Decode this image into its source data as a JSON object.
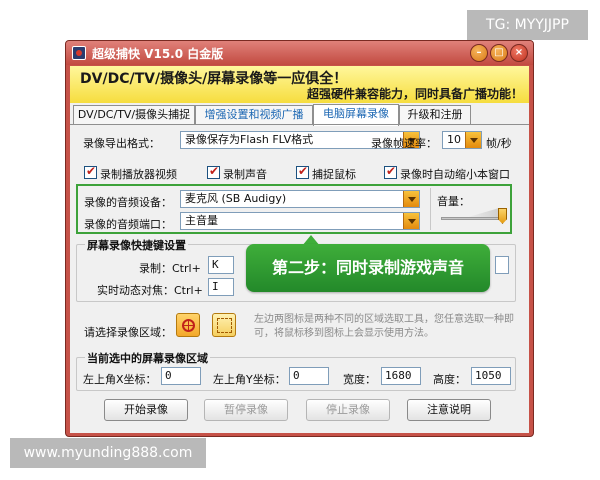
{
  "watermark": {
    "top_right": "TG: MYYJJPP",
    "bottom_left": "www.myunding888.com"
  },
  "window": {
    "title": "超级捕快 V15.0 白金版",
    "controls": {
      "minimize": "–",
      "maximize": "□",
      "close": "×"
    }
  },
  "banner": {
    "line1": "DV/DC/TV/摄像头/屏幕录像等一应俱全！",
    "line2": "超强硬件兼容能力，同时具备广播功能！"
  },
  "tabs": [
    {
      "label": "DV/DC/TV/摄像头捕捉",
      "active": false
    },
    {
      "label": "增强设置和视频广播",
      "active": false
    },
    {
      "label": "电脑屏幕录像",
      "active": true
    },
    {
      "label": "升级和注册",
      "active": false
    }
  ],
  "export_format": {
    "label": "录像导出格式：",
    "value": "录像保存为Flash FLV格式"
  },
  "frame_rate": {
    "label": "录像帧速率：",
    "value": "10",
    "unit": "帧/秒"
  },
  "checkboxes": [
    {
      "label": "录制播放器视频",
      "checked": true
    },
    {
      "label": "录制声音",
      "checked": true
    },
    {
      "label": "捕捉鼠标",
      "checked": true
    },
    {
      "label": "录像时自动缩小本窗口",
      "checked": true
    }
  ],
  "audio": {
    "device_label": "录像的音频设备：",
    "device_value": "麦克风 (SB Audigy)",
    "port_label": "录像的音频端口：",
    "port_value": "主音量",
    "volume_label": "音量：",
    "volume_level": 1.0
  },
  "hotkeys": {
    "title": "屏幕录像快捷键设置",
    "record_label": "录制：Ctrl+",
    "record_key": "K",
    "realtime_label": "实时动态对焦：Ctrl+",
    "realtime_key": "I"
  },
  "callout": "第二步：同时录制游戏声音",
  "area_select": {
    "label": "请选择录像区域：",
    "description": "左边两图标是两种不同的区域选取工具，您任意选取一种即可，将鼠标移到图标上会显示使用方法。"
  },
  "current_area": {
    "title": "当前选中的屏幕录像区域",
    "x_label": "左上角X坐标：",
    "x_value": "0",
    "y_label": "左上角Y坐标：",
    "y_value": "0",
    "w_label": "宽度：",
    "w_value": "1680",
    "h_label": "高度：",
    "h_value": "1050"
  },
  "buttons": {
    "start": "开始录像",
    "pause": "暂停录像",
    "stop": "停止录像",
    "help": "注意说明"
  }
}
